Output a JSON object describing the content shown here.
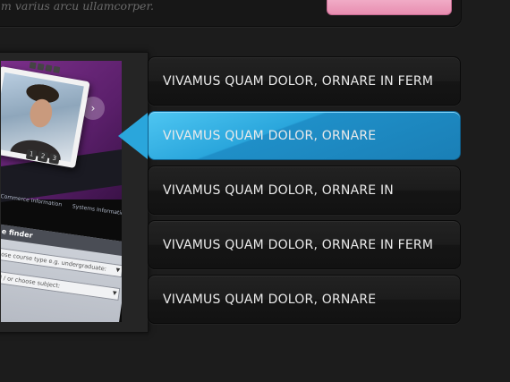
{
  "top": {
    "caption": "m varius arcu ullamcorper.",
    "pink_button_label": ""
  },
  "preview": {
    "pager": [
      "1",
      "2",
      "3"
    ],
    "next_glyph": "›",
    "tabs": [
      "Commerce Information",
      "Systems Informatics"
    ],
    "finder": {
      "title": "e finder",
      "course_placeholder": "oose course type e.g. undergraduate:",
      "subject_placeholder": "nd / or choose subject:"
    }
  },
  "nav": {
    "active_index": 1,
    "items": [
      {
        "label": "VIVAMUS QUAM DOLOR, ORNARE IN FERM"
      },
      {
        "label": "VIVAMUS QUAM DOLOR, ORNARE"
      },
      {
        "label": "VIVAMUS QUAM DOLOR, ORNARE IN"
      },
      {
        "label": "VIVAMUS QUAM DOLOR, ORNARE IN FERM"
      },
      {
        "label": "VIVAMUS QUAM DOLOR, ORNARE"
      }
    ]
  },
  "colors": {
    "background": "#1c1c1c",
    "active_accent": "#2aa6dc",
    "pink_button": "#f2a7c3",
    "purple_banner": "#7b2f8a"
  }
}
